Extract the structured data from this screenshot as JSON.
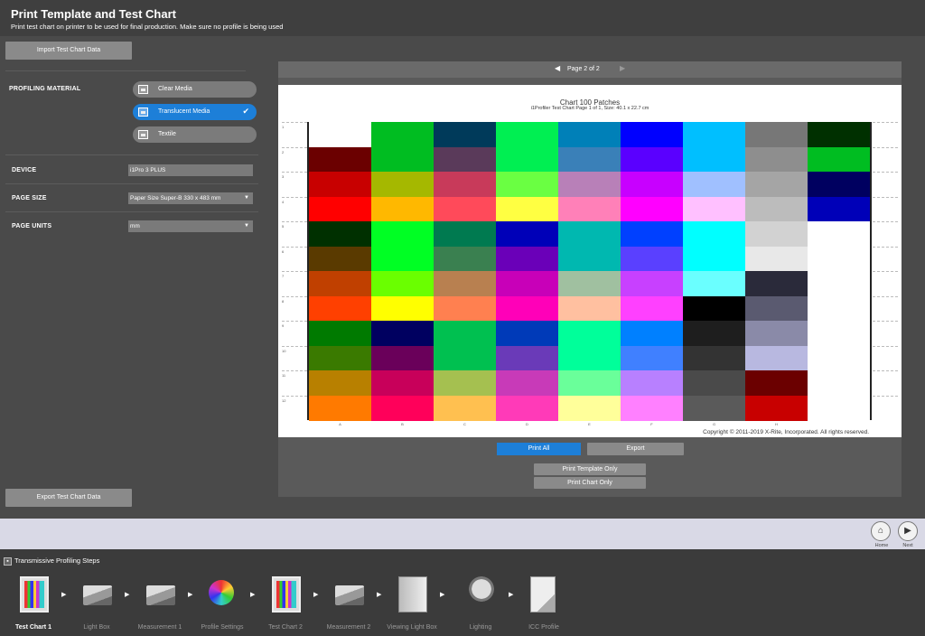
{
  "header": {
    "title": "Print Template and Test Chart",
    "subtitle": "Print test chart on printer to be used for final production. Make sure no profile is being used"
  },
  "left": {
    "import_label": "Import Test Chart Data",
    "export_label": "Export Test Chart Data",
    "profiling_material_label": "PROFILING MATERIAL",
    "materials": [
      {
        "label": "Clear Media",
        "selected": false
      },
      {
        "label": "Translucent Media",
        "selected": true
      },
      {
        "label": "Textile",
        "selected": false
      }
    ],
    "device_label": "DEVICE",
    "device_value": "i1Pro 3 PLUS",
    "page_size_label": "PAGE SIZE",
    "page_size_value": "Paper Size Super-B  330 x 483 mm",
    "page_units_label": "PAGE UNITS",
    "page_units_value": "mm"
  },
  "preview": {
    "page_label": "Page 2 of 2",
    "chart_title": "Chart 100 Patches",
    "chart_subtitle": "i1Profiler Test Chart Page  1 of 1, Size: 40.1 x 22.7 cm",
    "copyright": "Copyright © 2011-2019 X-Rite, Incorporated. All rights reserved.",
    "row_labels": [
      "1",
      "2",
      "3",
      "4",
      "5",
      "6",
      "7",
      "8",
      "9",
      "10",
      "11",
      "12"
    ],
    "col_labels": [
      "A",
      "B",
      "C",
      "D",
      "E",
      "F",
      "G",
      "H"
    ],
    "columns": [
      [
        "#ffffff",
        "#6b0000",
        "#c80000",
        "#ff0000",
        "#003000",
        "#5a3a00",
        "#c04000",
        "#ff4000",
        "#007a00",
        "#3a7a00",
        "#b88000",
        "#ff7a00"
      ],
      [
        "#00bd21",
        "#00bd21",
        "#a5b800",
        "#ffb800",
        "#00ff24",
        "#00ff24",
        "#6aff00",
        "#ffff00",
        "#000060",
        "#6a005a",
        "#c8005a",
        "#ff005a"
      ],
      [
        "#003a5a",
        "#5a3a5a",
        "#c83a5a",
        "#ff4a5a",
        "#007a50",
        "#3a8050",
        "#b88050",
        "#ff8050",
        "#00c050",
        "#00c050",
        "#a5c050",
        "#ffc050"
      ],
      [
        "#00ef52",
        "#00ef52",
        "#6aff42",
        "#ffff42",
        "#0000b8",
        "#6a00b8",
        "#c800b8",
        "#ff00b8",
        "#003ab8",
        "#6a3ab8",
        "#c83ab8",
        "#ff3ab8"
      ],
      [
        "#0080b8",
        "#3a80b8",
        "#b880b8",
        "#ff80b8",
        "#00b8b0",
        "#00b8b0",
        "#a0c0a0",
        "#ffc0a0",
        "#00ff9a",
        "#00ff9a",
        "#6aff9a",
        "#ffff9a"
      ],
      [
        "#0000ff",
        "#5a00ff",
        "#c800ff",
        "#ff00ff",
        "#0040ff",
        "#5a40ff",
        "#c840ff",
        "#ff40ff",
        "#0080ff",
        "#4080ff",
        "#b880ff",
        "#ff80ff"
      ],
      [
        "#00bfff",
        "#00bfff",
        "#a0c0ff",
        "#ffc0ff",
        "#00ffff",
        "#00ffff",
        "#6affff",
        "#000000",
        "#1e1e1e",
        "#333333",
        "#4a4a4a",
        "#5a5a5a"
      ],
      [
        "#777777",
        "#8e8e8e",
        "#a5a5a5",
        "#bcbcbc",
        "#d2d2d2",
        "#e8e8e8",
        "#2a2a3a",
        "#5a5a70",
        "#8a8aa8",
        "#b8b8e0",
        "#6b0000",
        "#c80000"
      ],
      [
        "#003000",
        "#00bd21",
        "#000060",
        "#0000b8",
        "#ffffff",
        "#ffffff",
        "#ffffff",
        "#ffffff",
        "#ffffff",
        "#ffffff",
        "#ffffff",
        "#ffffff"
      ]
    ],
    "print_all_label": "Print All",
    "export_label": "Export",
    "print_template_label": "Print Template Only",
    "print_chart_label": "Print Chart Only"
  },
  "nav": {
    "home_label": "Home",
    "next_label": "Next"
  },
  "steps": {
    "title": "Transmissive Profiling Steps",
    "items": [
      {
        "label": "Test Chart 1",
        "active": true,
        "icon": "chart-icon"
      },
      {
        "label": "Light Box",
        "active": false,
        "icon": "lightbox-icon"
      },
      {
        "label": "Measurement 1",
        "active": false,
        "icon": "measurement-icon"
      },
      {
        "label": "Profile Settings",
        "active": false,
        "icon": "gear-color-icon"
      },
      {
        "label": "Test Chart 2",
        "active": false,
        "icon": "chart-icon"
      },
      {
        "label": "Measurement 2",
        "active": false,
        "icon": "measurement-icon"
      },
      {
        "label": "Viewing Light Box",
        "active": false,
        "icon": "viewing-box-icon"
      },
      {
        "label": "Lighting",
        "active": false,
        "icon": "bulb-icon"
      },
      {
        "label": "ICC Profile",
        "active": false,
        "icon": "icc-file-icon"
      }
    ]
  }
}
